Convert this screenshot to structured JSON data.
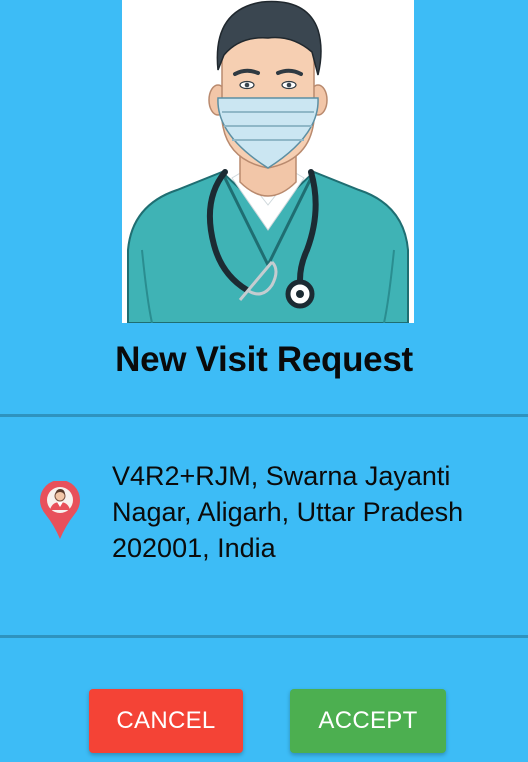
{
  "header": {
    "illustration": "doctor-with-mask-and-stethoscope",
    "title": "New Visit Request"
  },
  "location": {
    "icon": "location-pin-icon",
    "address": "V4R2+RJM, Swarna Jayanti Nagar, Aligarh, Uttar Pradesh 202001, India"
  },
  "actions": {
    "cancel_label": "CANCEL",
    "accept_label": "ACCEPT"
  },
  "colors": {
    "background": "#3dbcf6",
    "divider": "#2e93bf",
    "cancel": "#f44336",
    "accept": "#4caf50",
    "pin": "#e8505b"
  }
}
